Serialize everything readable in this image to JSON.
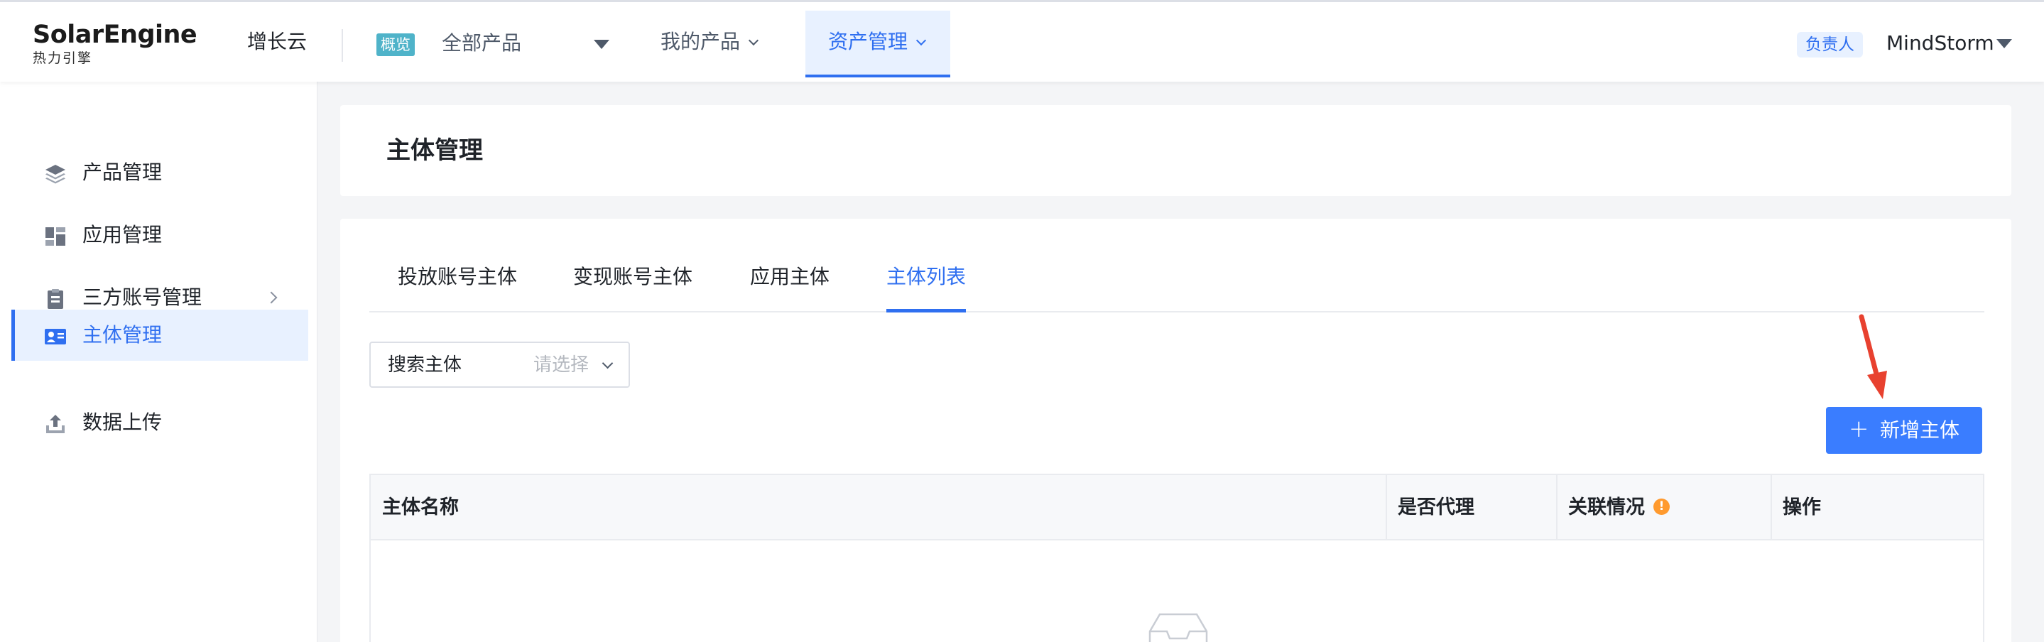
{
  "header": {
    "logo_text": "SolarEngine",
    "logo_sub": "热力引擎",
    "product_name": "增长云",
    "overview_tag": "概览",
    "all_products": "全部产品",
    "nav": [
      {
        "label": "我的产品"
      },
      {
        "label": "资产管理",
        "active": true
      }
    ],
    "owner_badge": "负责人",
    "user_name": "MindStorm"
  },
  "sidebar": {
    "items": [
      {
        "label": "产品管理",
        "icon": "layers-icon"
      },
      {
        "label": "应用管理",
        "icon": "apps-grid-icon"
      },
      {
        "label": "三方账号管理",
        "icon": "clipboard-icon",
        "has_children": true
      },
      {
        "label": "主体管理",
        "icon": "id-card-icon",
        "active": true
      },
      {
        "label": "数据上传",
        "icon": "upload-icon"
      }
    ]
  },
  "page": {
    "title": "主体管理",
    "tabs": [
      {
        "label": "投放账号主体"
      },
      {
        "label": "变现账号主体"
      },
      {
        "label": "应用主体"
      },
      {
        "label": "主体列表",
        "active": true
      }
    ],
    "search": {
      "label": "搜索主体",
      "placeholder": "请选择"
    },
    "add_button": {
      "icon": "+",
      "label": "新增主体"
    },
    "table": {
      "columns": [
        "主体名称",
        "是否代理",
        "关联情况",
        "操作"
      ],
      "rows": []
    }
  },
  "colors": {
    "accent": "#2f6ff0",
    "button": "#3a7dff",
    "annotation_arrow": "#e8412f",
    "warning": "#ff9a2e",
    "overview_tag": "#4fb3c9"
  }
}
